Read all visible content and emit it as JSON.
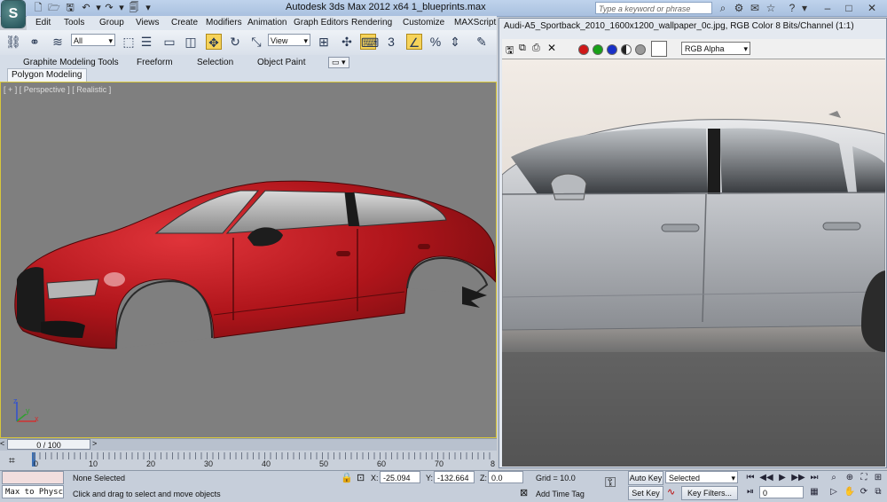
{
  "app": {
    "logo_letter": "S",
    "title": "Autodesk 3ds Max  2012 x64     1_blueprints.max",
    "search_placeholder": "Type a keyword or phrase"
  },
  "menu": [
    "Edit",
    "Tools",
    "Group",
    "Views",
    "Create",
    "Modifiers",
    "Animation",
    "Graph Editors",
    "Rendering",
    "Customize",
    "MAXScript"
  ],
  "toolbar": {
    "selection_filter": "All",
    "ref_coord": "View",
    "snap_label": "3"
  },
  "ribbon": {
    "tabs": [
      "Graphite Modeling Tools",
      "Freeform",
      "Selection",
      "Object Paint"
    ],
    "sub_label": "Polygon Modeling"
  },
  "viewport": {
    "label": "[ + ] [ Perspective ] [ Realistic ]",
    "axis_x": "x",
    "axis_y": "y",
    "axis_z": "z",
    "car_color": "#b0151b"
  },
  "timeline": {
    "frame_label": "0 / 100",
    "ticks": [
      "0",
      "10",
      "20",
      "30",
      "40",
      "50",
      "60",
      "70",
      "8"
    ]
  },
  "status": {
    "maxscript_listener": "Max to Physc",
    "selection_info": "None Selected",
    "prompt": "Click and drag to select and move objects",
    "x_label": "X:",
    "x_value": "-25.094",
    "y_label": "Y:",
    "y_value": "-132.664",
    "z_label": "Z:",
    "z_value": "0.0",
    "grid": "Grid = 10.0",
    "add_time_tag": "Add Time Tag",
    "auto_key": "Auto Key",
    "set_key": "Set Key",
    "selected_combo": "Selected",
    "key_filters": "Key Filters...",
    "current_frame": "0"
  },
  "image_window": {
    "title": "Audi-A5_Sportback_2010_1600x1200_wallpaper_0c.jpg, RGB Color 8 Bits/Channel (1:1)",
    "channel": "RGB Alpha"
  }
}
